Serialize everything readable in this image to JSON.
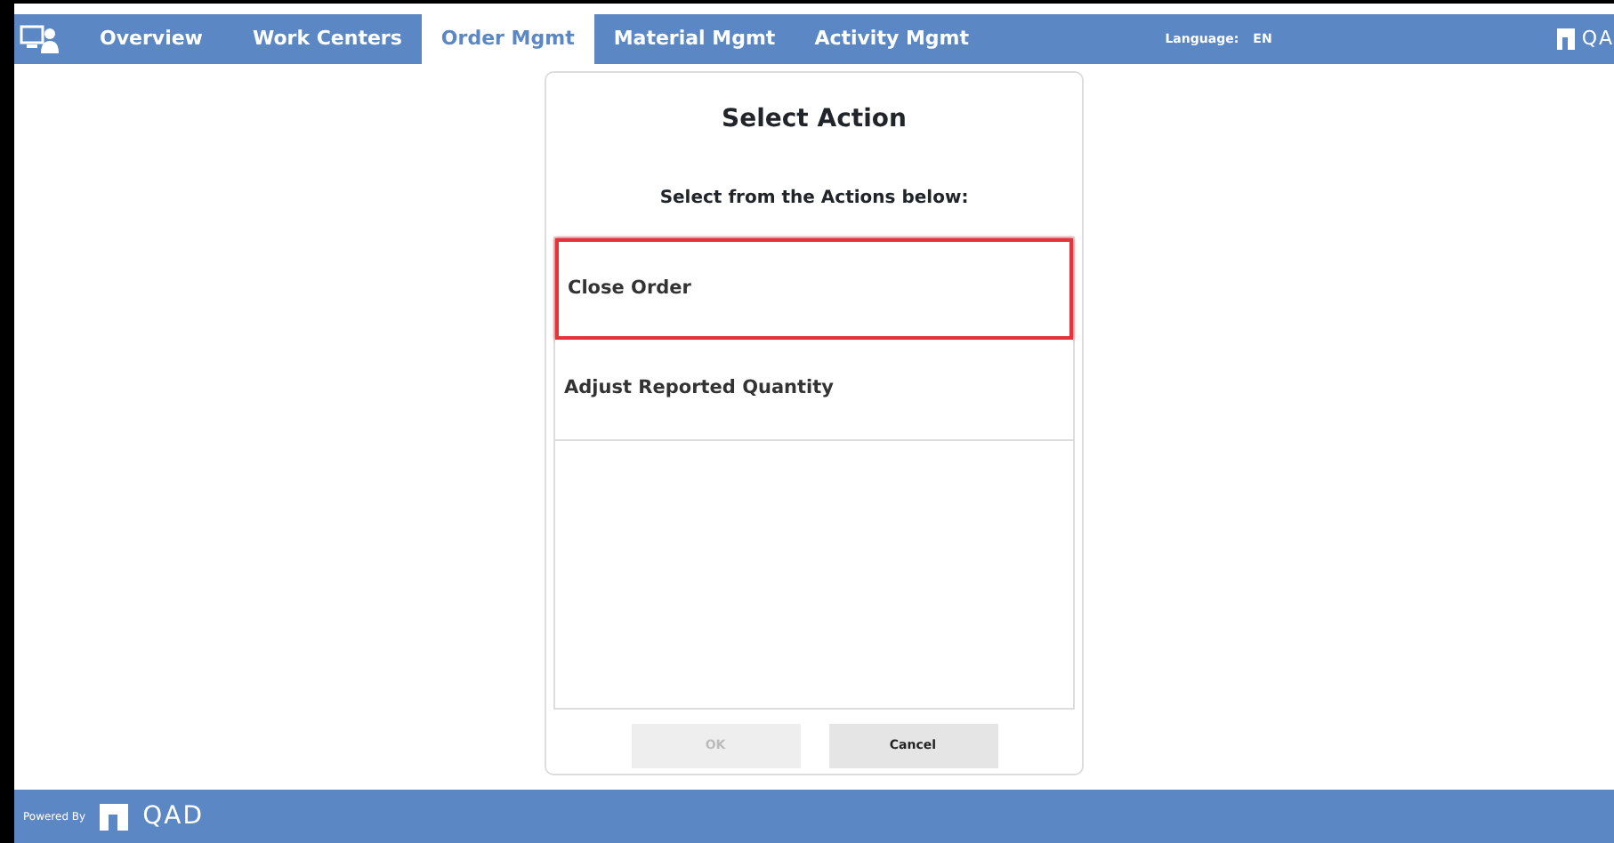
{
  "nav": {
    "tabs": [
      {
        "label": "Overview",
        "selected": false
      },
      {
        "label": "Work Centers",
        "selected": false
      },
      {
        "label": "Order Mgmt",
        "selected": true
      },
      {
        "label": "Material Mgmt",
        "selected": false
      },
      {
        "label": "Activity Mgmt",
        "selected": false
      }
    ],
    "language_label": "Language:",
    "language": "EN",
    "logo": "QA"
  },
  "dialog": {
    "title": "Select Action",
    "subtitle": "Select from the Actions below:",
    "actions": [
      {
        "label": "Close Order",
        "selected": true
      },
      {
        "label": "Adjust Reported Quantity",
        "selected": false
      }
    ],
    "buttons": [
      {
        "label": "OK",
        "disabled": true
      },
      {
        "label": "Cancel",
        "disabled": false
      }
    ]
  },
  "footer": {
    "powered_by": "Powered By",
    "logo": "QAD"
  }
}
